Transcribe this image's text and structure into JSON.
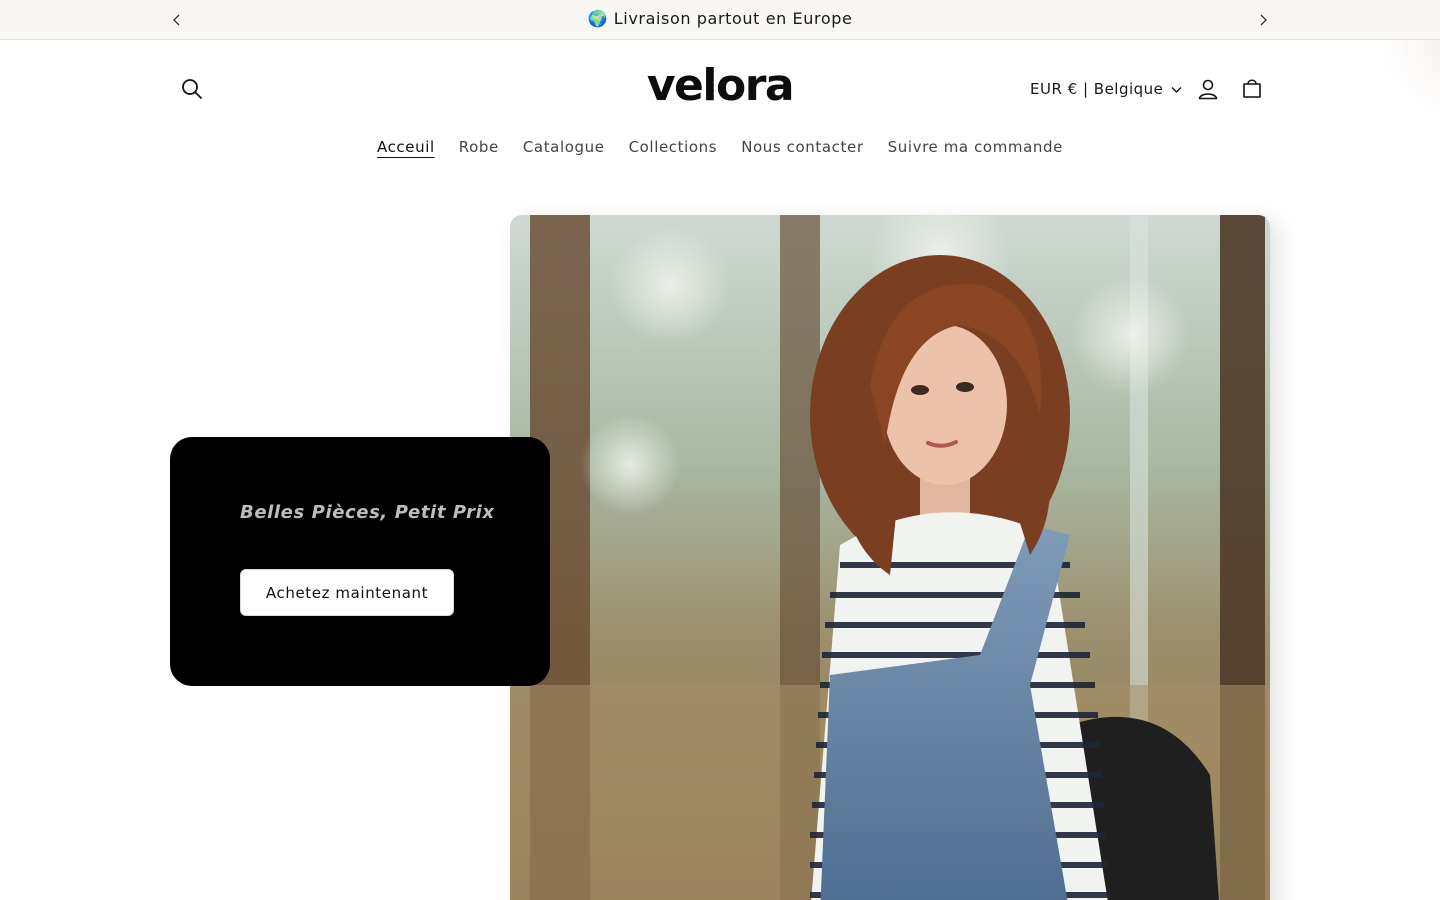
{
  "announcement": {
    "globe": "🌍",
    "text": "Livraison partout en Europe"
  },
  "header": {
    "logo": "velora",
    "locale": "EUR € | Belgique"
  },
  "nav": {
    "items": [
      "Acceuil",
      "Robe",
      "Catalogue",
      "Collections",
      "Nous contacter",
      "Suivre ma commande"
    ],
    "active": "Acceuil"
  },
  "hero": {
    "tagline": "Belles Pièces, Petit Prix",
    "cta": "Achetez maintenant"
  },
  "icons": {
    "search": "search-icon",
    "account": "account-icon",
    "cart": "cart-icon",
    "prev": "chevron-left-icon",
    "next": "chevron-right-icon",
    "locale_dropdown": "chevron-down-icon"
  },
  "colors": {
    "announcement_bg": "#f8f7f3",
    "promo_bg": "#000000",
    "tagline": "#bdbdbd",
    "text": "#121212"
  }
}
